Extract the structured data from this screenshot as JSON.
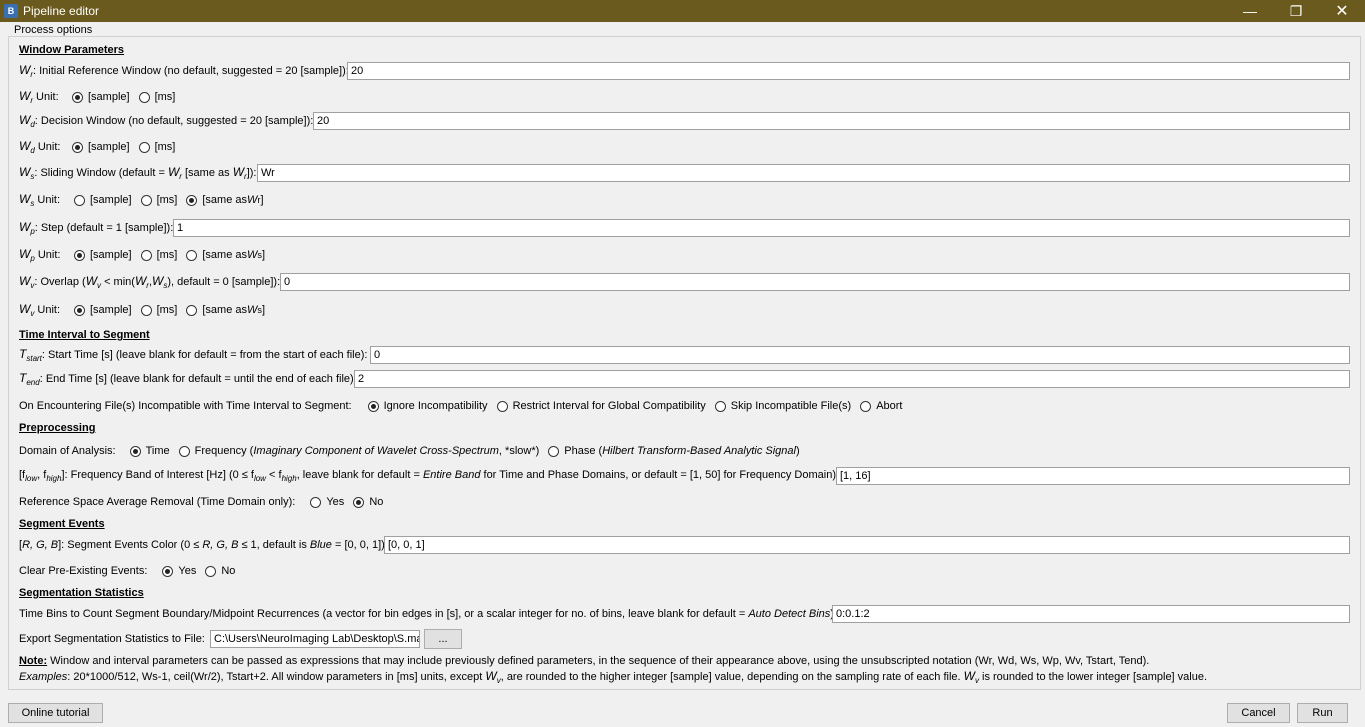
{
  "window": {
    "title": "Pipeline editor",
    "logo": "B",
    "minimize": "—",
    "maximize": "❐",
    "close": "✕"
  },
  "group_title": "Process options",
  "sections": {
    "window_params": "Window Parameters",
    "time_interval": "Time Interval to Segment",
    "preprocessing": "Preprocessing",
    "segment_events": "Segment Events",
    "seg_stats": "Segmentation Statistics"
  },
  "wr": {
    "sym": "W",
    "sub": "r",
    "text": ": Initial Reference Window (no default, suggested = 20 [sample]):",
    "value": "20"
  },
  "wr_unit": {
    "sym": "W",
    "sub": "r",
    "text": " Unit:",
    "options": [
      "[sample]",
      "[ms]"
    ],
    "selected": 0
  },
  "wd": {
    "sym": "W",
    "sub": "d",
    "text": ": Decision Window (no default, suggested = 20 [sample]):",
    "value": "20"
  },
  "wd_unit": {
    "sym": "W",
    "sub": "d",
    "text": " Unit:",
    "options": [
      "[sample]",
      "[ms]"
    ],
    "selected": 0
  },
  "ws": {
    "sym": "W",
    "sub": "s",
    "text1": ": Sliding Window (default = ",
    "sym2": "W",
    "sub2": "r",
    "text2": " [same as ",
    "sym3": "W",
    "sub3": "r",
    "text3": "]):",
    "value": "Wr"
  },
  "ws_unit": {
    "sym": "W",
    "sub": "s",
    "text": " Unit:",
    "options": [
      "[sample]",
      "[ms]",
      "[same as "
    ],
    "opt_sym": "W",
    "opt_sub": "r",
    "opt_end": "]",
    "selected": 2
  },
  "wp": {
    "sym": "W",
    "sub": "p",
    "text": ": Step (default = 1 [sample]):",
    "value": "1"
  },
  "wp_unit": {
    "sym": "W",
    "sub": "p",
    "text": " Unit:",
    "options": [
      "[sample]",
      "[ms]",
      "[same as "
    ],
    "opt_sym": "W",
    "opt_sub": "s",
    "opt_end": "]",
    "selected": 0
  },
  "wv": {
    "sym": "W",
    "sub": "v",
    "text1": ": Overlap (",
    "sym2": "W",
    "sub2": "v",
    "text2": " < min(",
    "sym3": "W",
    "sub3": "r",
    "text3": ",",
    "sym4": "W",
    "sub4": "s",
    "text4": "), default = 0 [sample]):",
    "value": "0"
  },
  "wv_unit": {
    "sym": "W",
    "sub": "v",
    "text": " Unit:",
    "options": [
      "[sample]",
      "[ms]",
      "[same as "
    ],
    "opt_sym": "W",
    "opt_sub": "s",
    "opt_end": "]",
    "selected": 0
  },
  "tstart": {
    "sym": "T",
    "sub": "start",
    "text": ": Start Time [s] (leave blank for default = from the start of each file):",
    "value": "0"
  },
  "tend": {
    "sym": "T",
    "sub": "end",
    "text": ": End Time [s] (leave blank for default = until the end of each file):",
    "value": "2"
  },
  "incompat": {
    "label": "On Encountering File(s) Incompatible with Time Interval to Segment:",
    "options": [
      "Ignore Incompatibility",
      "Restrict Interval for Global Compatibility",
      "Skip Incompatible File(s)",
      "Abort"
    ],
    "selected": 0
  },
  "domain": {
    "label": "Domain of Analysis:",
    "opt_time": "Time",
    "opt_freq": "Frequency (",
    "opt_freq_i": "Imaginary Component of Wavelet Cross-Spectrum",
    "opt_freq_end": ", *slow*)",
    "opt_phase": "Phase (",
    "opt_phase_i": "Hilbert Transform-Based Analytic Signal",
    "opt_phase_end": ")",
    "selected": 0
  },
  "fband": {
    "pre": "[f",
    "sub1": "low",
    "mid": ", f",
    "sub2": "high",
    "text1": "]: Frequency Band of Interest [Hz] (0 ≤ f",
    "sub3": "low",
    "text2": " < f",
    "sub4": "high",
    "text3": ", leave blank for default = ",
    "ital1": "Entire Band",
    "text4": " for Time and Phase Domains, or default = [1, 50] for Frequency Domain):",
    "value": "[1, 16]"
  },
  "refspace": {
    "label": "Reference Space Average Removal (Time Domain only):",
    "options": [
      "Yes",
      "No"
    ],
    "selected": 1
  },
  "rgb": {
    "pre": "[",
    "ital": "R, G, B",
    "text1": "]: Segment Events Color (0 ≤ ",
    "ital2": "R, G, B",
    "text2": " ≤ 1, default is ",
    "ital3": "Blue",
    "text3": " = [0, 0, 1]):",
    "value": "[0, 0, 1]"
  },
  "clear_events": {
    "label": "Clear Pre-Existing Events:",
    "options": [
      "Yes",
      "No"
    ],
    "selected": 0
  },
  "timebins": {
    "text": "Time Bins to Count Segment Boundary/Midpoint Recurrences (a vector for bin edges in [s], or a scalar integer for no. of bins, leave blank for default = ",
    "ital": "Auto Detect Bins",
    "text2": "):",
    "value": "0:0.1:2"
  },
  "export": {
    "label": "Export Segmentation Statistics to File:",
    "value": "C:\\Users\\NeuroImaging Lab\\Desktop\\S.mat",
    "browse": "..."
  },
  "note1": {
    "bold": "Note:",
    "text": " Window and interval parameters can be passed as expressions that may include previously defined parameters, in the sequence of their appearance above, using the unsubscripted notation (Wr, Wd, Ws, Wp, Wv, Tstart, Tend)."
  },
  "note2": {
    "ital": "Examples",
    "text1": ": 20*1000/512, Ws-1, ceil(Wr/2), Tstart+2. All window parameters in [ms] units, except ",
    "sym": "W",
    "sub": "v",
    "text2": ", are rounded to the higher integer [sample] value, depending on the sampling rate of each file. ",
    "sym2": "W",
    "sub2": "v",
    "text3": " is rounded to the lower integer [sample] value."
  },
  "buttons": {
    "tutorial": "Online tutorial",
    "cancel": "Cancel",
    "run": "Run"
  }
}
